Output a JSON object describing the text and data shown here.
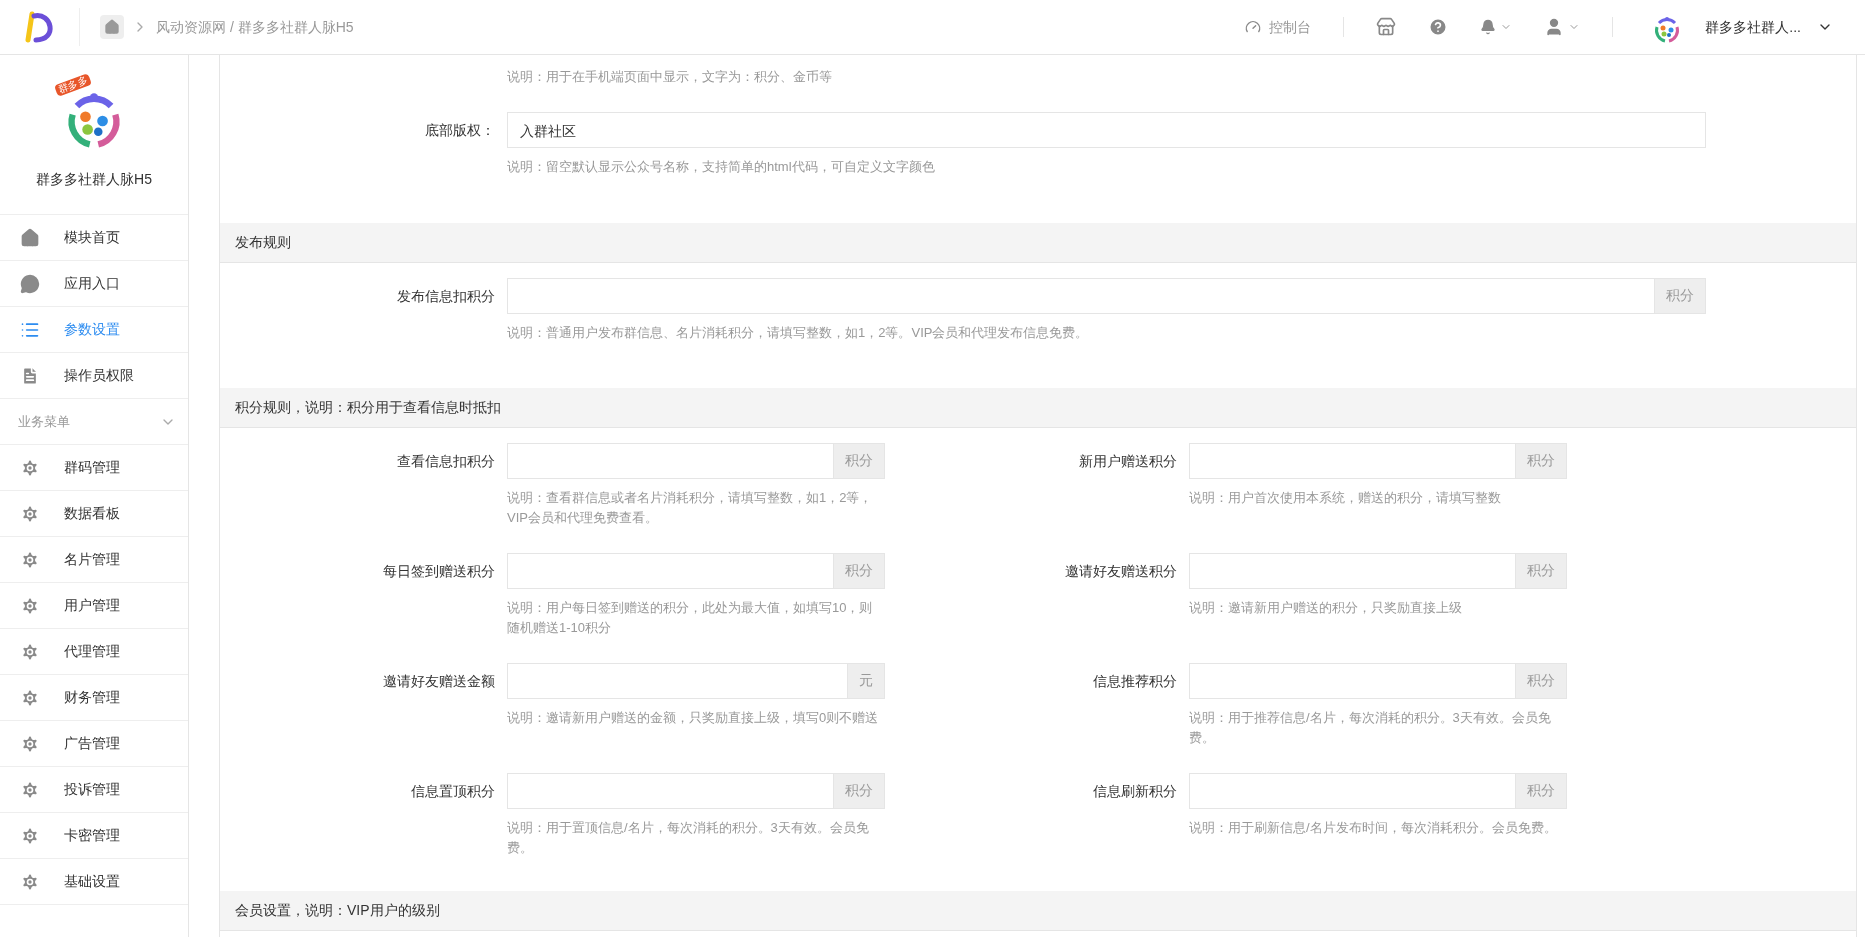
{
  "header": {
    "breadcrumb": "风动资源网 / 群多多社群人脉H5",
    "console": "控制台",
    "account": "群多多社群人..."
  },
  "sidebar": {
    "app_name": "群多多社群人脉H5",
    "logo_badge": "群多多",
    "items": [
      {
        "label": "模块首页",
        "kind": "home",
        "selected": false
      },
      {
        "label": "应用入口",
        "kind": "chat",
        "selected": false
      },
      {
        "label": "参数设置",
        "kind": "list",
        "selected": true
      },
      {
        "label": "操作员权限",
        "kind": "doc",
        "selected": false
      }
    ],
    "group": {
      "title": "业务菜单",
      "expanded": true,
      "items": [
        {
          "label": "群码管理",
          "selected": false
        },
        {
          "label": "数据看板",
          "selected": false
        },
        {
          "label": "名片管理",
          "selected": false
        },
        {
          "label": "用户管理",
          "selected": false
        },
        {
          "label": "代理管理",
          "selected": false
        },
        {
          "label": "财务管理",
          "selected": false
        },
        {
          "label": "广告管理",
          "selected": false
        },
        {
          "label": "投诉管理",
          "selected": false
        },
        {
          "label": "卡密管理",
          "selected": false
        },
        {
          "label": "基础设置",
          "selected": false
        }
      ]
    }
  },
  "top_block": {
    "note": "说明：用于在手机端页面中显示，文字为：积分、金币等",
    "field": {
      "label": "底部版权：",
      "value": "入群社区",
      "note": "说明：留空默认显示公众号名称，支持简单的html代码，可自定义文字颜色"
    }
  },
  "sections": [
    {
      "title": "发布规则",
      "kind": "single",
      "fields": [
        {
          "label": "发布信息扣积分",
          "addon": "积分",
          "note": "说明：普通用户发布群信息、名片消耗积分，请填写整数，如1，2等。VIP会员和代理发布信息免费。"
        }
      ]
    },
    {
      "title": "积分规则，说明：积分用于查看信息时抵扣",
      "kind": "double",
      "fields": [
        {
          "label": "查看信息扣积分",
          "addon": "积分",
          "note": "说明：查看群信息或者名片消耗积分，请填写整数，如1，2等，VIP会员和代理免费查看。"
        },
        {
          "label": "新用户赠送积分",
          "addon": "积分",
          "note": "说明：用户首次使用本系统，赠送的积分，请填写整数"
        },
        {
          "label": "每日签到赠送积分",
          "addon": "积分",
          "note": "说明：用户每日签到赠送的积分，此处为最大值，如填写10，则随机赠送1-10积分"
        },
        {
          "label": "邀请好友赠送积分",
          "addon": "积分",
          "note": "说明：邀请新用户赠送的积分，只奖励直接上级"
        },
        {
          "label": "邀请好友赠送金额",
          "addon": "元",
          "note": "说明：邀请新用户赠送的金额，只奖励直接上级，填写0则不赠送"
        },
        {
          "label": "信息推荐积分",
          "addon": "积分",
          "note": "说明：用于推荐信息/名片，每次消耗的积分。3天有效。会员免费。"
        },
        {
          "label": "信息置顶积分",
          "addon": "积分",
          "note": "说明：用于置顶信息/名片，每次消耗的积分。3天有效。会员免费。"
        },
        {
          "label": "信息刷新积分",
          "addon": "积分",
          "note": "说明：用于刷新信息/名片发布时间，每次消耗积分。会员免费。"
        }
      ]
    },
    {
      "title": "会员设置，说明：VIP用户的级别",
      "kind": "heading"
    }
  ]
}
